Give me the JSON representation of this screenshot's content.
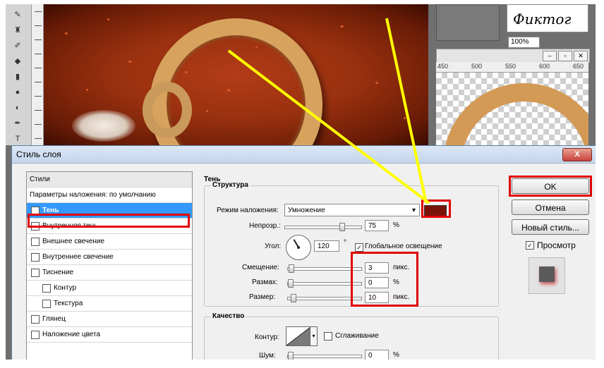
{
  "bg": {
    "logo_text": "Фиктог",
    "zoom": "100%",
    "ruler_labels": [
      "450",
      "500",
      "550",
      "600",
      "650"
    ]
  },
  "dialog": {
    "title": "Стиль слоя",
    "close_label": "X",
    "styles_header": "Стили",
    "styles_items": [
      {
        "label": "Параметры наложения: по умолчанию",
        "checkbox": false,
        "checked": false,
        "indent": false
      },
      {
        "label": "Тень",
        "checkbox": true,
        "checked": true,
        "indent": false
      },
      {
        "label": "Внутренняя тень",
        "checkbox": true,
        "checked": false,
        "indent": false
      },
      {
        "label": "Внешнее свечение",
        "checkbox": true,
        "checked": false,
        "indent": false
      },
      {
        "label": "Внутреннее свечение",
        "checkbox": true,
        "checked": false,
        "indent": false
      },
      {
        "label": "Тиснение",
        "checkbox": true,
        "checked": false,
        "indent": false
      },
      {
        "label": "Контур",
        "checkbox": true,
        "checked": false,
        "indent": true
      },
      {
        "label": "Текстура",
        "checkbox": true,
        "checked": false,
        "indent": true
      },
      {
        "label": "Глянец",
        "checkbox": true,
        "checked": false,
        "indent": false
      },
      {
        "label": "Наложение цвета",
        "checkbox": true,
        "checked": false,
        "indent": false
      }
    ],
    "shadow_title": "Тень",
    "structure": {
      "title": "Структура",
      "blend_mode_label": "Режим наложения:",
      "blend_mode_value": "Умножение",
      "shadow_color": "#7a120a",
      "opacity_label": "Непрозр.:",
      "opacity_value": "75",
      "opacity_unit": "%",
      "opacity_level": 0.75,
      "angle_label": "Угол:",
      "angle_value": "120",
      "angle_unit": "°",
      "global_light_label": "Глобальное освещение",
      "global_light_checked": true,
      "distance_label": "Смещение:",
      "distance_value": "3",
      "distance_unit": "пикс.",
      "distance_level": 0.01,
      "spread_label": "Размах:",
      "spread_value": "0",
      "spread_unit": "%",
      "spread_level": 0,
      "size_label": "Размер:",
      "size_value": "10",
      "size_unit": "пикс.",
      "size_level": 0.04
    },
    "quality": {
      "title": "Качество",
      "contour_label": "Контур:",
      "antialias_label": "Сглаживание",
      "antialias_checked": false,
      "noise_label": "Шум:",
      "noise_value": "0",
      "noise_unit": "%"
    },
    "buttons": {
      "ok": "OK",
      "cancel": "Отмена",
      "new_style": "Новый стиль...",
      "preview_label": "Просмотр",
      "preview_checked": true
    }
  },
  "colors": {
    "highlight_red": "#e00000",
    "arrow_yellow": "#ffff00",
    "selection_blue": "#3399ff"
  }
}
